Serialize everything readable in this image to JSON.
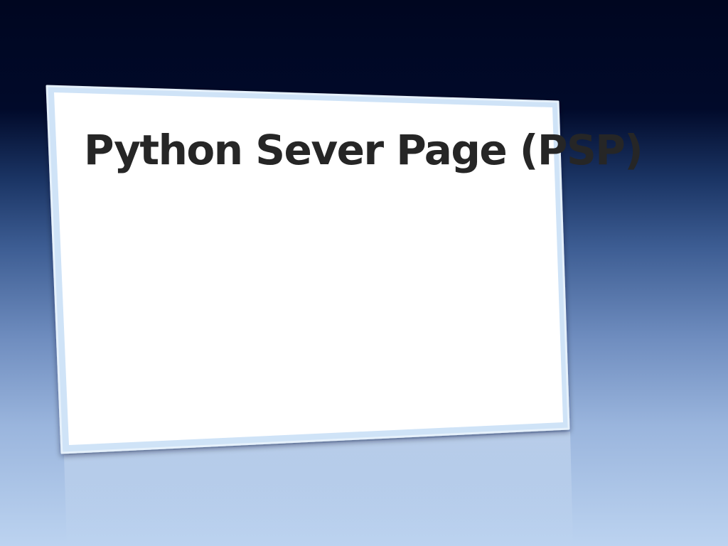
{
  "slide": {
    "title": "Python Sever Page (PSP)"
  },
  "colors": {
    "background_top": "#000620",
    "background_bottom": "#bcd3f0",
    "panel_fill": "#ffffff",
    "panel_border": "#cfe3f7",
    "title_text": "#262626"
  }
}
